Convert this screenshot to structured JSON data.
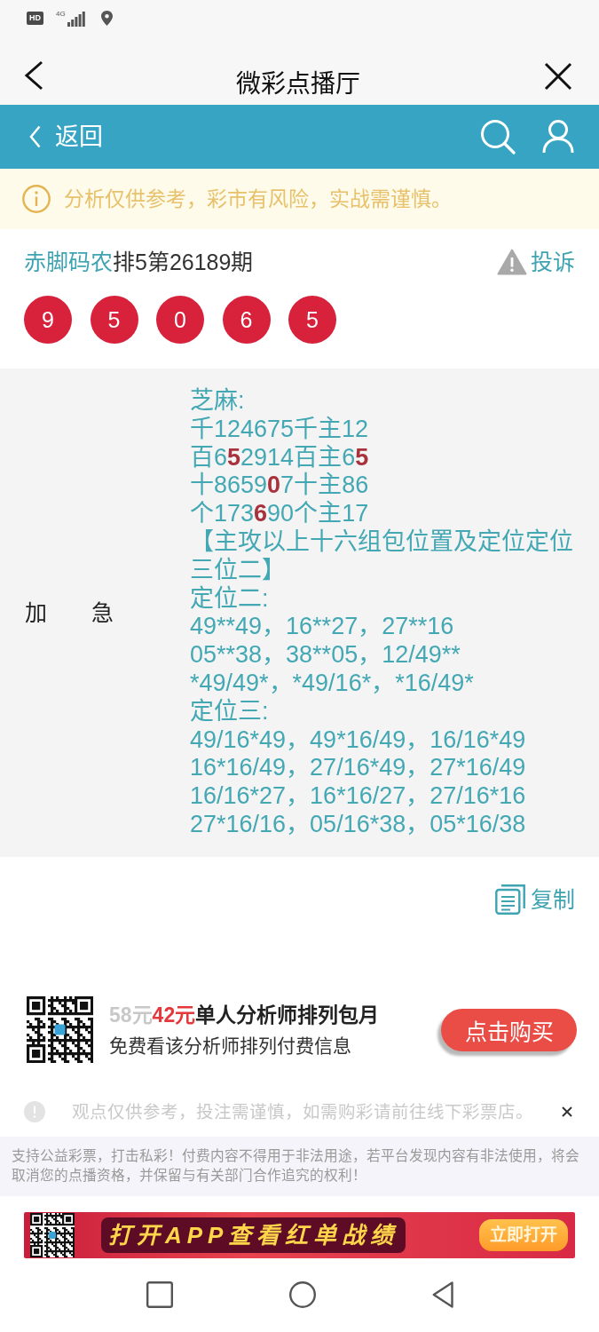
{
  "status_bar": {
    "hd_badge": "HD",
    "network": "4G"
  },
  "title_bar": {
    "title": "微彩点播厅"
  },
  "nav_bar": {
    "back_label": "返回"
  },
  "notice": {
    "text": "分析仅供参考，彩市有风险，实战需谨慎。"
  },
  "post": {
    "author": "赤脚码农",
    "issue": "排5第26189期",
    "report_label": "投诉",
    "balls": [
      "9",
      "5",
      "0",
      "6",
      "5"
    ]
  },
  "content": {
    "label": "加　　急",
    "lines": [
      {
        "parts": [
          {
            "text": "芝麻:",
            "highlight": false
          }
        ]
      },
      {
        "parts": [
          {
            "text": "千124675千主12",
            "highlight": false
          }
        ]
      },
      {
        "parts": [
          {
            "text": "百6",
            "highlight": false
          },
          {
            "text": "5",
            "highlight": true
          },
          {
            "text": "2914百主6",
            "highlight": false
          },
          {
            "text": "5",
            "highlight": true
          }
        ]
      },
      {
        "parts": [
          {
            "text": "十8659",
            "highlight": false
          },
          {
            "text": "0",
            "highlight": true
          },
          {
            "text": "7十主86",
            "highlight": false
          }
        ]
      },
      {
        "parts": [
          {
            "text": "个173",
            "highlight": false
          },
          {
            "text": "6",
            "highlight": true
          },
          {
            "text": "90个主17",
            "highlight": false
          }
        ]
      },
      {
        "parts": [
          {
            "text": "【主攻以上十六组包位置及定位定位三位二】",
            "highlight": false
          }
        ]
      },
      {
        "parts": [
          {
            "text": "定位二:",
            "highlight": false
          }
        ]
      },
      {
        "parts": [
          {
            "text": "49**49，16**27，27**16",
            "highlight": false
          }
        ]
      },
      {
        "parts": [
          {
            "text": "05**38，38**05，12/49**",
            "highlight": false
          }
        ]
      },
      {
        "parts": [
          {
            "text": "*49/49*，*49/16*，*16/49*",
            "highlight": false
          }
        ]
      },
      {
        "parts": [
          {
            "text": "定位三:",
            "highlight": false
          }
        ]
      },
      {
        "parts": [
          {
            "text": "49/16*49，49*16/49，16/16*49",
            "highlight": false
          }
        ]
      },
      {
        "parts": [
          {
            "text": "16*16/49，27/16*49，27*16/49",
            "highlight": false
          }
        ]
      },
      {
        "parts": [
          {
            "text": "16/16*27，16*16/27，27/16*16",
            "highlight": false
          }
        ]
      },
      {
        "parts": [
          {
            "text": "27*16/16，05/16*38，05*16/38",
            "highlight": false
          }
        ]
      }
    ]
  },
  "copy_label": "复制",
  "promo": {
    "old_price": "58元",
    "price": "42元",
    "title": "单人分析师排列包月",
    "subtitle": "免费看该分析师排列付费信息",
    "button": "点击购买"
  },
  "disclaimer": {
    "text": "观点仅供参考，投注需谨慎，如需购彩请前往线下彩票店。"
  },
  "legal": "支持公益彩票，打击私彩！付费内容不得用于非法用途，若平台发现内容有非法使用，将会取消您的点播资格，并保留与有关部门合作追究的权利！",
  "banner": {
    "text": "打开APP查看红单战绩",
    "button": "立即打开"
  }
}
